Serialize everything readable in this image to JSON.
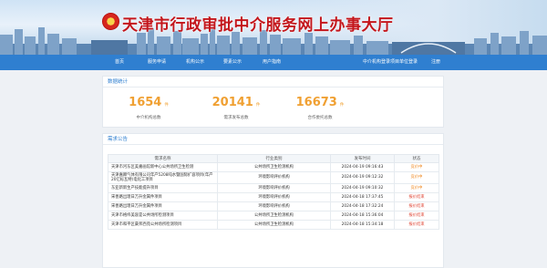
{
  "site": {
    "title": "天津市行政审批中介服务网上办事大厅"
  },
  "nav": {
    "left": [
      "首页",
      "服务申请",
      "机构公示",
      "要素公示",
      "用户指南"
    ],
    "right": [
      "中介机构登录",
      "项目单位登录",
      "注册"
    ]
  },
  "stats": {
    "title": "数据统计",
    "items": [
      {
        "value": "1654",
        "unit": "件",
        "label": "中介机构总数"
      },
      {
        "value": "20141",
        "unit": "件",
        "label": "需求发布总数"
      },
      {
        "value": "16673",
        "unit": "件",
        "label": "合作委托总数"
      }
    ]
  },
  "notice": {
    "title": "需求公告",
    "columns": [
      "需求名称",
      "行业类别",
      "发布时间",
      "状态"
    ],
    "rows": [
      {
        "name": "天津市河东区美嘉画馆新中心公共场所卫生检测",
        "industry": "公共场所卫生检测机构",
        "time": "2024-04-19 09:16:43",
        "status": "竞价中",
        "status_type": "bid"
      },
      {
        "name": "天津嘉卿气体有限公司年产5208吨水暨国际扩容项目(年产20亿标瓦特)电化工项目",
        "industry": "环境影响评价机构",
        "time": "2024-04-19 09:12:32",
        "status": "竞价中",
        "status_type": "bid"
      },
      {
        "name": "东亚新新生产技能提升项目",
        "industry": "环境影响评价机构",
        "time": "2024-04-19 09:10:32",
        "status": "竞价中",
        "status_type": "bid"
      },
      {
        "name": "宋善路出理日万升金属件项目",
        "industry": "环境影响评价机构",
        "time": "2024-04-18 17:37:45",
        "status": "报价结束",
        "status_type": "end"
      },
      {
        "name": "宋善路出理日万升金属件项目",
        "industry": "环境影响评价机构",
        "time": "2024-04-18 17:32:24",
        "status": "报价结束",
        "status_type": "end"
      },
      {
        "name": "天津市格纬美容是公共场所检测项目",
        "industry": "公共场所卫生检测机构",
        "time": "2024-04-18 15:36:04",
        "status": "报价结束",
        "status_type": "end"
      },
      {
        "name": "天津市和平区豪邦西苑公共场所检测项目",
        "industry": "公共场所卫生检测机构",
        "time": "2024-04-18 15:34:18",
        "status": "报价结束",
        "status_type": "end"
      }
    ]
  }
}
